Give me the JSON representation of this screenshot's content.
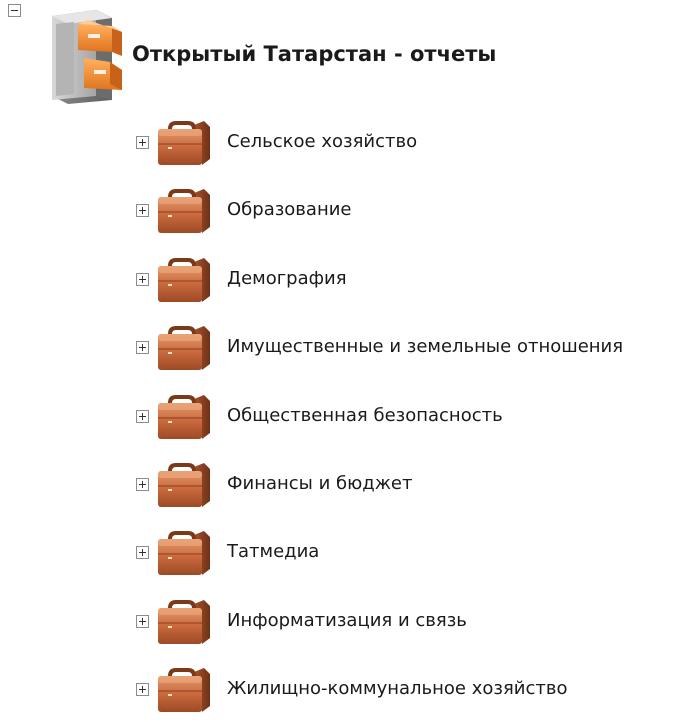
{
  "tree": {
    "root": {
      "label": "Открытый Татарстан - отчеты",
      "expanded": true,
      "icon": "file-cabinet-icon"
    },
    "items": [
      {
        "label": "Сельское хозяйство",
        "expanded": false,
        "icon": "briefcase-icon"
      },
      {
        "label": "Образование",
        "expanded": false,
        "icon": "briefcase-icon"
      },
      {
        "label": "Демография",
        "expanded": false,
        "icon": "briefcase-icon"
      },
      {
        "label": "Имущественные и земельные отношения",
        "expanded": false,
        "icon": "briefcase-icon"
      },
      {
        "label": "Общественная безопасность",
        "expanded": false,
        "icon": "briefcase-icon"
      },
      {
        "label": "Финансы и бюджет",
        "expanded": false,
        "icon": "briefcase-icon"
      },
      {
        "label": "Татмедиа",
        "expanded": false,
        "icon": "briefcase-icon"
      },
      {
        "label": "Информатизация и связь",
        "expanded": false,
        "icon": "briefcase-icon"
      },
      {
        "label": "Жилищно-коммунальное хозяйство",
        "expanded": false,
        "icon": "briefcase-icon"
      }
    ]
  },
  "colors": {
    "briefcase": "#c0683e",
    "cabinet": "#9a9a9a",
    "drawer": "#f08a2a"
  }
}
